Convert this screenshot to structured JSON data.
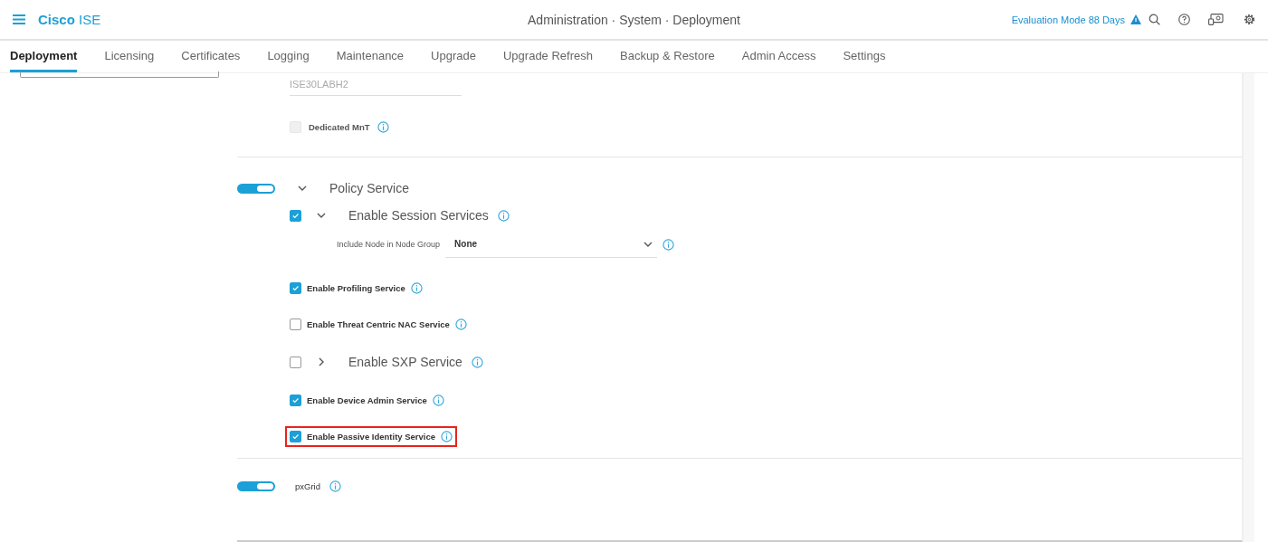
{
  "header": {
    "brand": "**Cisco** ISE",
    "title": "Administration · System · Deployment",
    "evaluation": "Evaluation Mode 88 Days"
  },
  "tabs": [
    {
      "label": "Deployment",
      "selected": true
    },
    {
      "label": "Licensing",
      "selected": false
    },
    {
      "label": "Certificates",
      "selected": false
    },
    {
      "label": "Logging",
      "selected": false
    },
    {
      "label": "Maintenance",
      "selected": false
    },
    {
      "label": "Upgrade",
      "selected": false
    },
    {
      "label": "Upgrade Refresh",
      "selected": false
    },
    {
      "label": "Backup & Restore",
      "selected": false
    },
    {
      "label": "Admin Access",
      "selected": false
    },
    {
      "label": "Settings",
      "selected": false
    }
  ],
  "hostname_field": {
    "value": "ISE30LABH2"
  },
  "dedicated_mnt": {
    "label": "Dedicated MnT",
    "checked": false,
    "disabled": true
  },
  "policy_service": {
    "label": "Policy Service",
    "on": true,
    "expanded": true,
    "session_services": {
      "label": "Enable Session Services",
      "checked": true,
      "expanded": true
    },
    "node_group": {
      "label": "Include Node in Node Group",
      "value": "None"
    },
    "services": [
      {
        "kind": "checkbox",
        "label": "Enable Profiling Service",
        "checked": true,
        "highlighted": false
      },
      {
        "kind": "checkbox",
        "label": "Enable Threat Centric NAC Service",
        "checked": false,
        "highlighted": false
      },
      {
        "kind": "expandable",
        "label": "Enable SXP Service",
        "checked": false,
        "expanded": false,
        "highlighted": false
      },
      {
        "kind": "checkbox",
        "label": "Enable Device Admin Service",
        "checked": true,
        "highlighted": false
      },
      {
        "kind": "checkbox",
        "label": "Enable Passive Identity Service",
        "checked": true,
        "highlighted": true
      }
    ]
  },
  "pxgrid": {
    "label": "pxGrid",
    "on": true
  }
}
